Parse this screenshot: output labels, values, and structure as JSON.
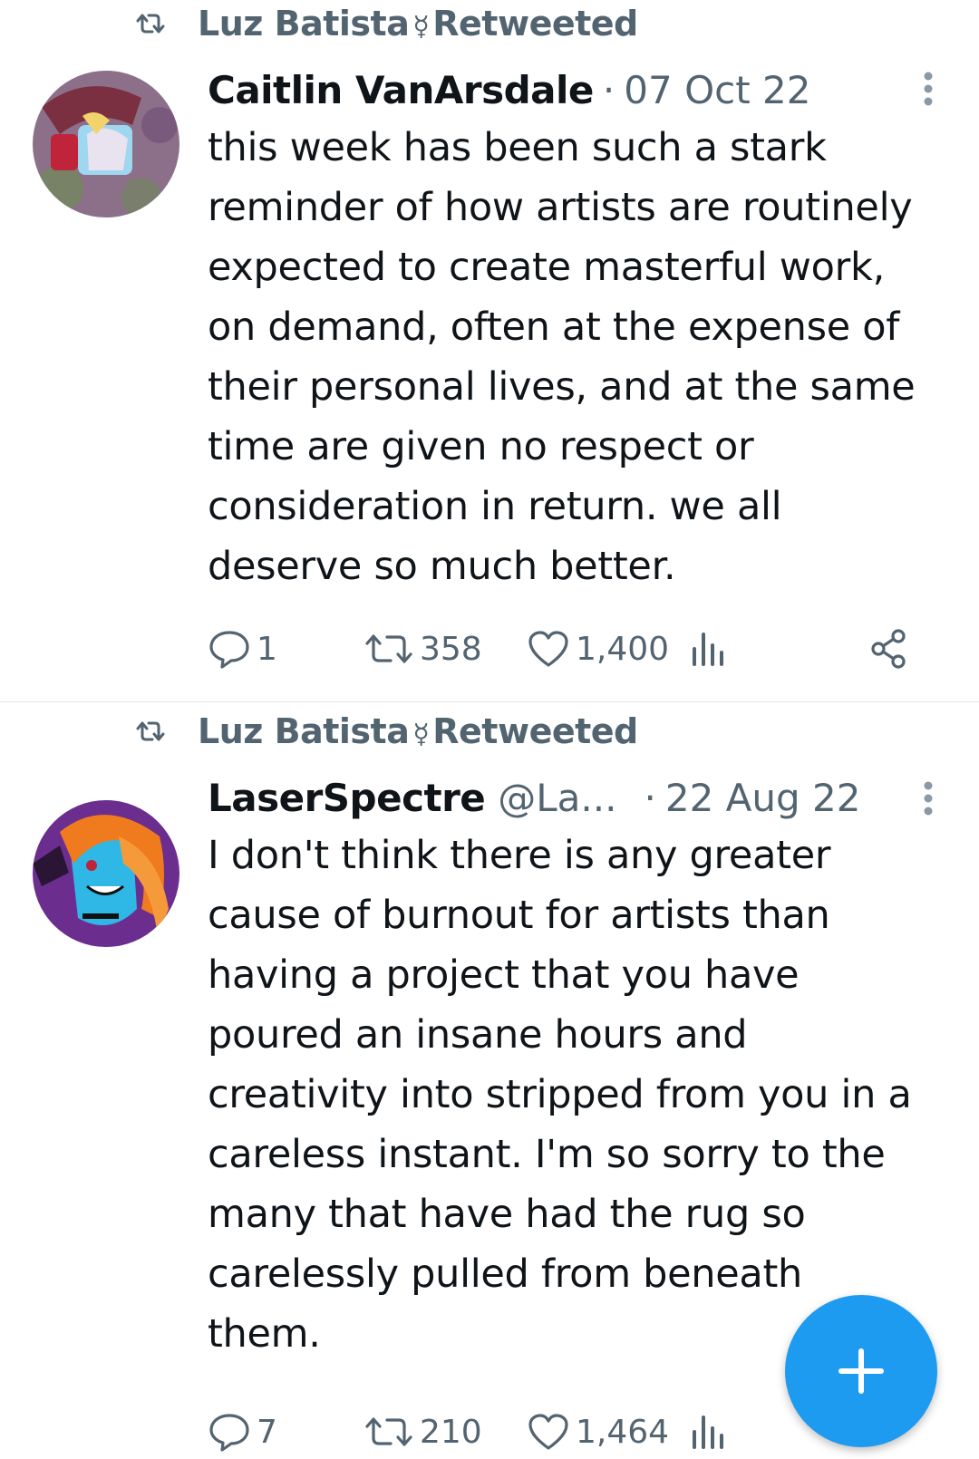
{
  "tweets": [
    {
      "retweeted_by": "Luz Batista",
      "retweeted_symbol": "☿",
      "retweeted_label": "Retweeted",
      "author_name": "Caitlin VanArsdale",
      "author_handle": "",
      "dot": "·",
      "date": "07 Oct 22",
      "text_lines": [
        "this week has been such a stark",
        "reminder of how artists are routinely",
        "expected to create masterful work,",
        "on demand, often at the expense of",
        "their personal lives, and at the same",
        "time are given no respect or",
        "consideration in return. we all",
        "deserve so much better."
      ],
      "replies": "1",
      "retweets": "358",
      "likes": "1,400"
    },
    {
      "retweeted_by": "Luz Batista",
      "retweeted_symbol": "☿",
      "retweeted_label": "Retweeted",
      "author_name": "LaserSpectre",
      "author_handle": "@La...",
      "dot": "·",
      "date": "22 Aug 22",
      "text_lines": [
        "I don't think there is any greater",
        "cause of burnout for artists than",
        "having a project that you have",
        "poured an insane hours and",
        "creativity into stripped from you in a",
        "careless instant. I'm so sorry to the",
        "many that have had the rug so",
        "carelessly pulled from beneath",
        "them."
      ],
      "replies": "7",
      "retweets": "210",
      "likes": "1,464"
    }
  ],
  "fab": {
    "icon": "plus-icon",
    "color": "#1d9bf0"
  },
  "colors": {
    "secondary_text": "#536471",
    "primary_text": "#0f1419",
    "accent": "#1d9bf0"
  }
}
